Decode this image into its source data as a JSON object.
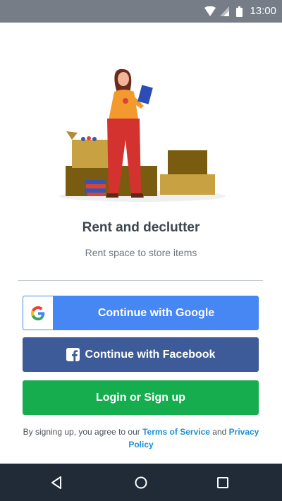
{
  "status_bar": {
    "time": "13:00",
    "icons": [
      "wifi-icon",
      "signal-icon",
      "battery-icon"
    ]
  },
  "hero": {
    "illustration": "woman-with-boxes-illustration",
    "title": "Rent and declutter",
    "subtitle": "Rent space to store items"
  },
  "auth": {
    "google_label": "Continue with Google",
    "facebook_label": "Continue with Facebook",
    "login_label": "Login or Sign up"
  },
  "terms": {
    "prefix": "By signing up, you agree to our",
    "tos_link": "Terms of Service",
    "and": "and",
    "privacy_link": "Privacy Policy"
  },
  "nav": {
    "back": "back-icon",
    "home": "home-icon",
    "recents": "recents-icon"
  },
  "colors": {
    "google_blue": "#4787f3",
    "facebook_blue": "#3d5b98",
    "login_green": "#16ad4f",
    "link_blue": "#1a8fd6",
    "status_bar": "#767d86",
    "nav_bar": "#212b37"
  }
}
